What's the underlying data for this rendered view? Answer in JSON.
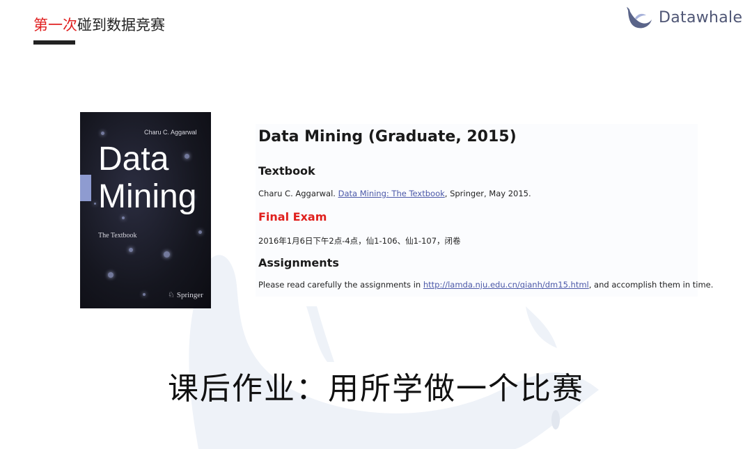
{
  "header": {
    "title_accent": "第一次",
    "title_rest": "碰到数据竞赛"
  },
  "logo": {
    "text": "Datawhale"
  },
  "book": {
    "author": "Charu C. Aggarwal",
    "title_line1": "Data",
    "title_line2": "Mining",
    "subtitle": "The Textbook",
    "publisher": "Springer"
  },
  "course": {
    "title": "Data Mining (Graduate, 2015)",
    "textbook_heading": "Textbook",
    "textbook_prefix": "Charu C. Aggarwal. ",
    "textbook_link": "Data Mining: The Textbook",
    "textbook_suffix": ", Springer, May 2015.",
    "exam_heading": "Final Exam",
    "exam_text": "2016年1月6日下午2点-4点，仙1-106、仙1-107，闭卷",
    "assignments_heading": "Assignments",
    "assignments_prefix": "Please read carefully the assignments in ",
    "assignments_link": "http://lamda.nju.edu.cn/qianh/dm15.html",
    "assignments_suffix": ", and accomplish them in time."
  },
  "homework_caption": "课后作业：用所学做一个比赛",
  "colors": {
    "accent_red": "#e02020",
    "logo_blue": "#4f5675",
    "link_blue": "#4b58a8",
    "watermark": "#eef2f8"
  }
}
